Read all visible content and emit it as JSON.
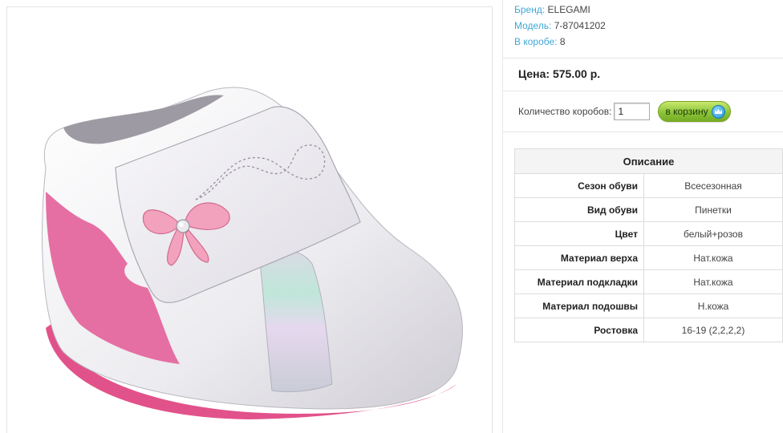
{
  "product": {
    "image_alt": "Пинетки ELEGAMI",
    "meta": [
      {
        "label": "Бренд:",
        "value": "ELEGAMI"
      },
      {
        "label": "Модель:",
        "value": "7-87041202"
      },
      {
        "label": "В коробе:",
        "value": "8"
      }
    ],
    "price": "Цена: 575.00 р.",
    "quantity": {
      "label": "Количество коробов:",
      "value": "1"
    },
    "cart_button": {
      "label": "в корзину",
      "icon": "crown-icon"
    }
  },
  "description": {
    "title": "Описание",
    "rows": [
      {
        "name": "Сезон обуви",
        "value": "Всесезонная"
      },
      {
        "name": "Вид обуви",
        "value": "Пинетки"
      },
      {
        "name": "Цвет",
        "value": "белый+розов"
      },
      {
        "name": "Материал верха",
        "value": "Нат.кожа"
      },
      {
        "name": "Материал подкладки",
        "value": "Нат.кожа"
      },
      {
        "name": "Материал подошвы",
        "value": "Н.кожа"
      },
      {
        "name": "Ростовка",
        "value": "16-19 (2,2,2,2)"
      }
    ]
  },
  "colors": {
    "label_blue": "#3fa7d6",
    "cart_green": "#8cc43a",
    "shoe_pink": "#e8609a"
  }
}
